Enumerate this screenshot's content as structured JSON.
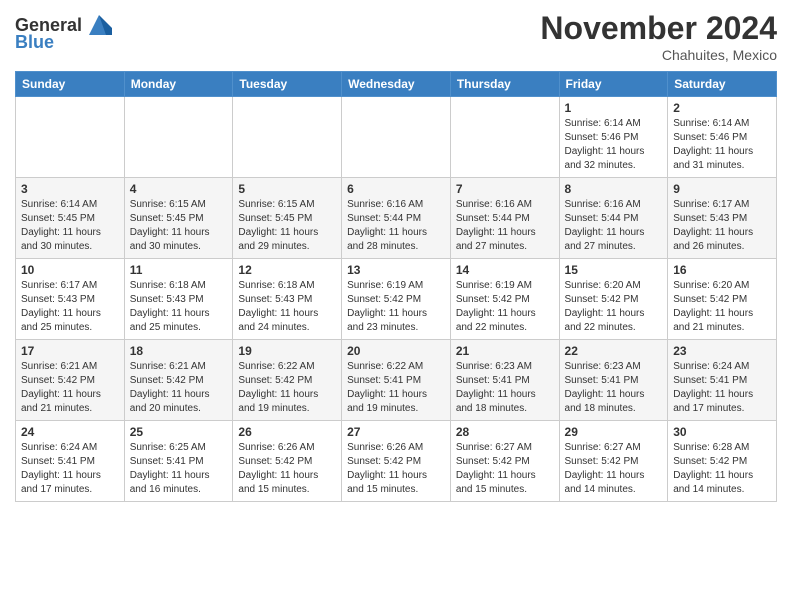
{
  "header": {
    "logo_general": "General",
    "logo_blue": "Blue",
    "month_title": "November 2024",
    "subtitle": "Chahuites, Mexico"
  },
  "days_of_week": [
    "Sunday",
    "Monday",
    "Tuesday",
    "Wednesday",
    "Thursday",
    "Friday",
    "Saturday"
  ],
  "weeks": [
    [
      {
        "day": "",
        "info": ""
      },
      {
        "day": "",
        "info": ""
      },
      {
        "day": "",
        "info": ""
      },
      {
        "day": "",
        "info": ""
      },
      {
        "day": "",
        "info": ""
      },
      {
        "day": "1",
        "info": "Sunrise: 6:14 AM\nSunset: 5:46 PM\nDaylight: 11 hours\nand 32 minutes."
      },
      {
        "day": "2",
        "info": "Sunrise: 6:14 AM\nSunset: 5:46 PM\nDaylight: 11 hours\nand 31 minutes."
      }
    ],
    [
      {
        "day": "3",
        "info": "Sunrise: 6:14 AM\nSunset: 5:45 PM\nDaylight: 11 hours\nand 30 minutes."
      },
      {
        "day": "4",
        "info": "Sunrise: 6:15 AM\nSunset: 5:45 PM\nDaylight: 11 hours\nand 30 minutes."
      },
      {
        "day": "5",
        "info": "Sunrise: 6:15 AM\nSunset: 5:45 PM\nDaylight: 11 hours\nand 29 minutes."
      },
      {
        "day": "6",
        "info": "Sunrise: 6:16 AM\nSunset: 5:44 PM\nDaylight: 11 hours\nand 28 minutes."
      },
      {
        "day": "7",
        "info": "Sunrise: 6:16 AM\nSunset: 5:44 PM\nDaylight: 11 hours\nand 27 minutes."
      },
      {
        "day": "8",
        "info": "Sunrise: 6:16 AM\nSunset: 5:44 PM\nDaylight: 11 hours\nand 27 minutes."
      },
      {
        "day": "9",
        "info": "Sunrise: 6:17 AM\nSunset: 5:43 PM\nDaylight: 11 hours\nand 26 minutes."
      }
    ],
    [
      {
        "day": "10",
        "info": "Sunrise: 6:17 AM\nSunset: 5:43 PM\nDaylight: 11 hours\nand 25 minutes."
      },
      {
        "day": "11",
        "info": "Sunrise: 6:18 AM\nSunset: 5:43 PM\nDaylight: 11 hours\nand 25 minutes."
      },
      {
        "day": "12",
        "info": "Sunrise: 6:18 AM\nSunset: 5:43 PM\nDaylight: 11 hours\nand 24 minutes."
      },
      {
        "day": "13",
        "info": "Sunrise: 6:19 AM\nSunset: 5:42 PM\nDaylight: 11 hours\nand 23 minutes."
      },
      {
        "day": "14",
        "info": "Sunrise: 6:19 AM\nSunset: 5:42 PM\nDaylight: 11 hours\nand 22 minutes."
      },
      {
        "day": "15",
        "info": "Sunrise: 6:20 AM\nSunset: 5:42 PM\nDaylight: 11 hours\nand 22 minutes."
      },
      {
        "day": "16",
        "info": "Sunrise: 6:20 AM\nSunset: 5:42 PM\nDaylight: 11 hours\nand 21 minutes."
      }
    ],
    [
      {
        "day": "17",
        "info": "Sunrise: 6:21 AM\nSunset: 5:42 PM\nDaylight: 11 hours\nand 21 minutes."
      },
      {
        "day": "18",
        "info": "Sunrise: 6:21 AM\nSunset: 5:42 PM\nDaylight: 11 hours\nand 20 minutes."
      },
      {
        "day": "19",
        "info": "Sunrise: 6:22 AM\nSunset: 5:42 PM\nDaylight: 11 hours\nand 19 minutes."
      },
      {
        "day": "20",
        "info": "Sunrise: 6:22 AM\nSunset: 5:41 PM\nDaylight: 11 hours\nand 19 minutes."
      },
      {
        "day": "21",
        "info": "Sunrise: 6:23 AM\nSunset: 5:41 PM\nDaylight: 11 hours\nand 18 minutes."
      },
      {
        "day": "22",
        "info": "Sunrise: 6:23 AM\nSunset: 5:41 PM\nDaylight: 11 hours\nand 18 minutes."
      },
      {
        "day": "23",
        "info": "Sunrise: 6:24 AM\nSunset: 5:41 PM\nDaylight: 11 hours\nand 17 minutes."
      }
    ],
    [
      {
        "day": "24",
        "info": "Sunrise: 6:24 AM\nSunset: 5:41 PM\nDaylight: 11 hours\nand 17 minutes."
      },
      {
        "day": "25",
        "info": "Sunrise: 6:25 AM\nSunset: 5:41 PM\nDaylight: 11 hours\nand 16 minutes."
      },
      {
        "day": "26",
        "info": "Sunrise: 6:26 AM\nSunset: 5:42 PM\nDaylight: 11 hours\nand 15 minutes."
      },
      {
        "day": "27",
        "info": "Sunrise: 6:26 AM\nSunset: 5:42 PM\nDaylight: 11 hours\nand 15 minutes."
      },
      {
        "day": "28",
        "info": "Sunrise: 6:27 AM\nSunset: 5:42 PM\nDaylight: 11 hours\nand 15 minutes."
      },
      {
        "day": "29",
        "info": "Sunrise: 6:27 AM\nSunset: 5:42 PM\nDaylight: 11 hours\nand 14 minutes."
      },
      {
        "day": "30",
        "info": "Sunrise: 6:28 AM\nSunset: 5:42 PM\nDaylight: 11 hours\nand 14 minutes."
      }
    ]
  ]
}
